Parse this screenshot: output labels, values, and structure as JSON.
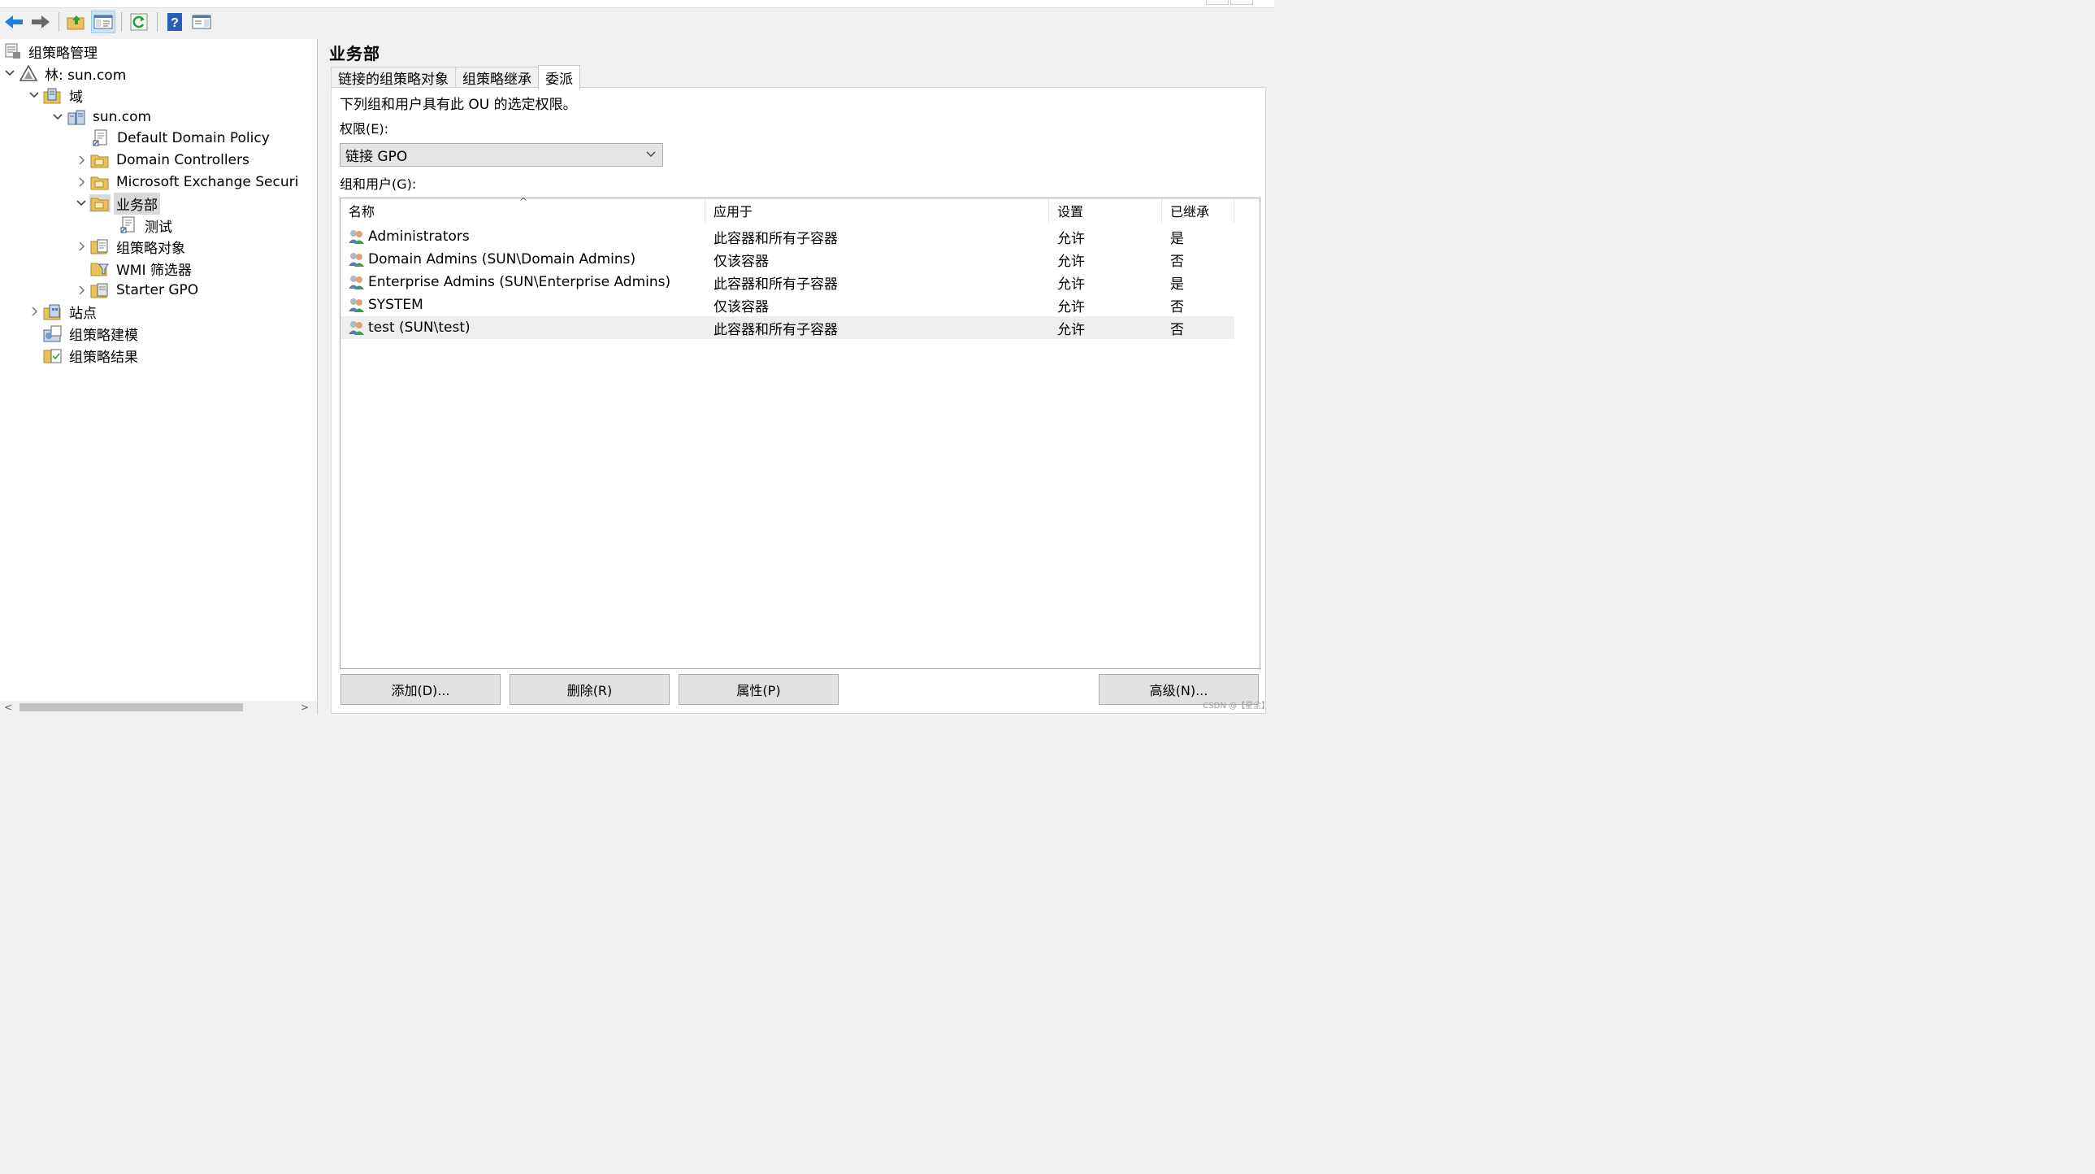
{
  "tree": {
    "root": "组策略管理",
    "forest": "林: sun.com",
    "domains": "域",
    "domain": "sun.com",
    "items": [
      {
        "label": "Default Domain Policy"
      },
      {
        "label": "Domain Controllers"
      },
      {
        "label": "Microsoft Exchange Securi"
      },
      {
        "label": "业务部"
      },
      {
        "label": "测试"
      },
      {
        "label": "组策略对象"
      },
      {
        "label": "WMI 筛选器"
      },
      {
        "label": "Starter GPO"
      }
    ],
    "sites": "站点",
    "modeling": "组策略建模",
    "results": "组策略结果"
  },
  "main": {
    "title": "业务部",
    "tabs": [
      "链接的组策略对象",
      "组策略继承",
      "委派"
    ],
    "active_tab": "委派",
    "description": "下列组和用户具有此 OU 的选定权限。",
    "permission_label": "权限(E):",
    "permission_value": "链接 GPO",
    "groups_label": "组和用户(G):",
    "columns": [
      "名称",
      "应用于",
      "设置",
      "已继承"
    ],
    "rows": [
      {
        "name": "Administrators",
        "applies": "此容器和所有子容器",
        "setting": "允许",
        "inherited": "是"
      },
      {
        "name": "Domain Admins (SUN\\Domain Admins)",
        "applies": "仅该容器",
        "setting": "允许",
        "inherited": "否"
      },
      {
        "name": "Enterprise Admins (SUN\\Enterprise Admins)",
        "applies": "此容器和所有子容器",
        "setting": "允许",
        "inherited": "是"
      },
      {
        "name": "SYSTEM",
        "applies": "仅该容器",
        "setting": "允许",
        "inherited": "否"
      },
      {
        "name": "test (SUN\\test)",
        "applies": "此容器和所有子容器",
        "setting": "允许",
        "inherited": "否"
      }
    ],
    "buttons": {
      "add": "添加(D)...",
      "remove": "删除(R)",
      "properties": "属性(P)",
      "advanced": "高级(N)..."
    }
  },
  "watermark": "CSDN @【星尘】",
  "colors": {
    "selection": "#d9d9d9",
    "folder": "#e8c35c",
    "accent_blue": "#1e6bd6"
  }
}
